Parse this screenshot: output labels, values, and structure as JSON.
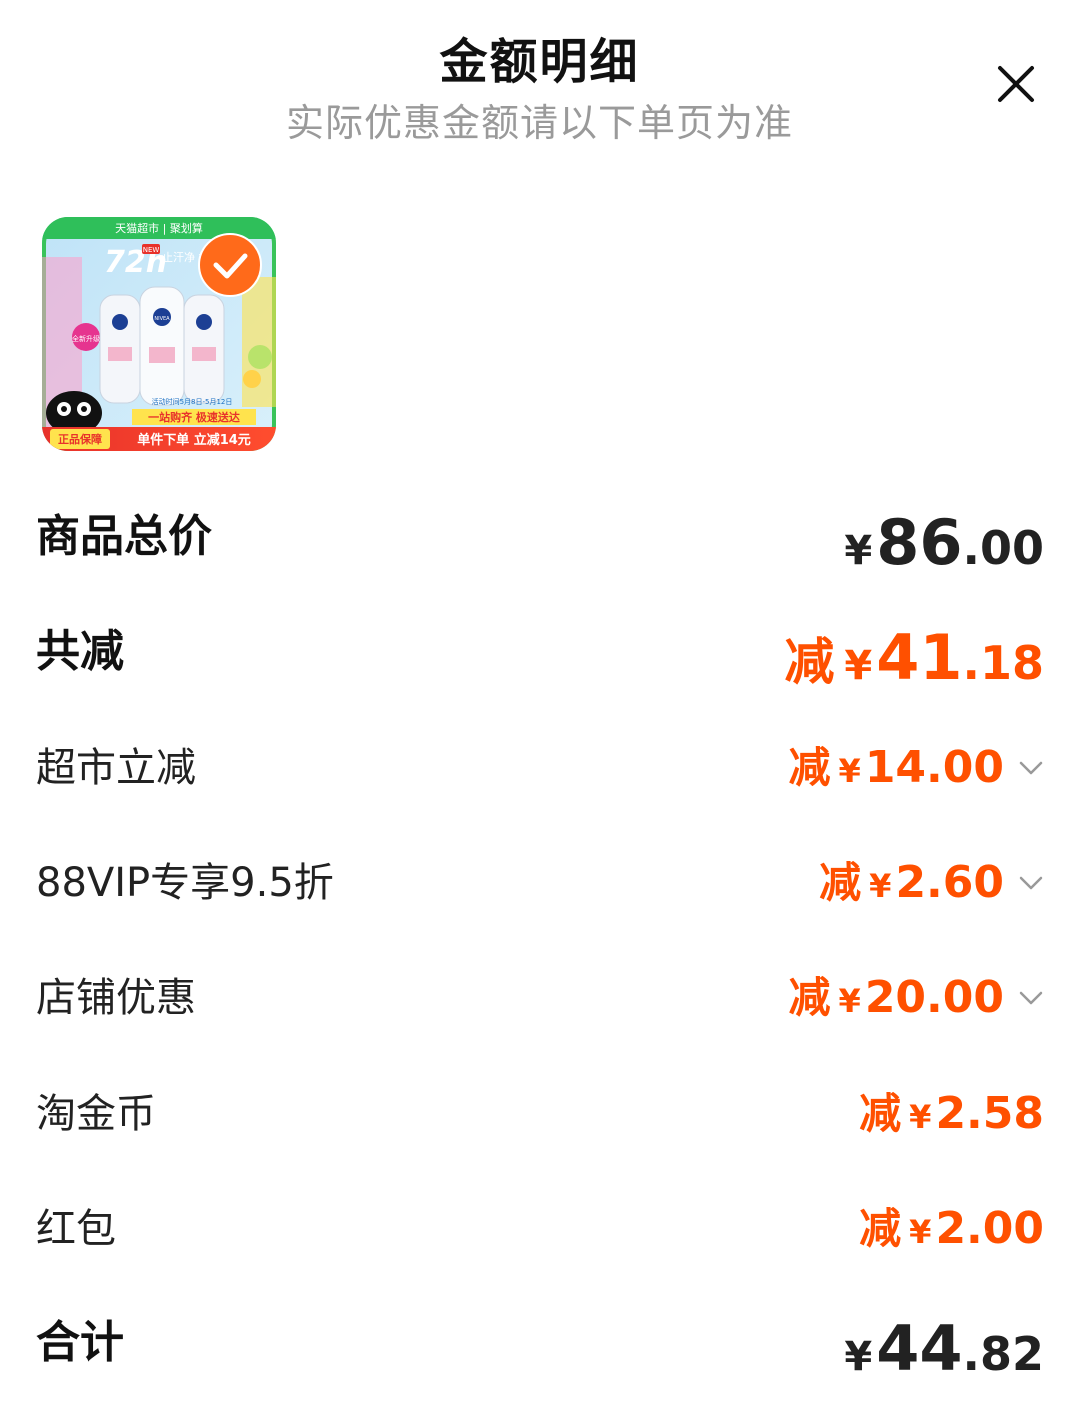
{
  "header": {
    "title": "金额明细",
    "subtitle": "实际优惠金额请以下单页为准"
  },
  "product_image": {
    "banner_text": "天猫超市 | 聚划算",
    "headline": "72h",
    "headline_note": "止汗净 持久干",
    "new_badge": "NEW",
    "side_badge": "全新升级",
    "promo_date": "活动时间5月8日-5月12日",
    "promo_line": "一站购齐 极速送达",
    "guarantee": "正品保障",
    "discount_text": "单件下单 立减14元",
    "brand": "NIVEA"
  },
  "colors": {
    "accent": "#ff5000",
    "text": "#222222",
    "subtitle": "#9a9a9a"
  },
  "rows": {
    "subtotal": {
      "label": "商品总价",
      "currency": "¥",
      "int": "86",
      "dec": ".00"
    },
    "total_discount": {
      "label": "共减",
      "prefix": "减",
      "currency": "¥",
      "int": "41",
      "dec": ".18"
    },
    "supermarket": {
      "label": "超市立减",
      "prefix": "减",
      "currency": "¥",
      "value": "14.00"
    },
    "vip": {
      "label": "88VIP专享9.5折",
      "prefix": "减",
      "currency": "¥",
      "value": "2.60"
    },
    "store": {
      "label": "店铺优惠",
      "prefix": "减",
      "currency": "¥",
      "value": "20.00"
    },
    "coins": {
      "label": "淘金币",
      "prefix": "减",
      "currency": "¥",
      "value": "2.58"
    },
    "redpacket": {
      "label": "红包",
      "prefix": "减",
      "currency": "¥",
      "value": "2.00"
    },
    "total": {
      "label": "合计",
      "currency": "¥",
      "int": "44",
      "dec": ".82"
    }
  }
}
